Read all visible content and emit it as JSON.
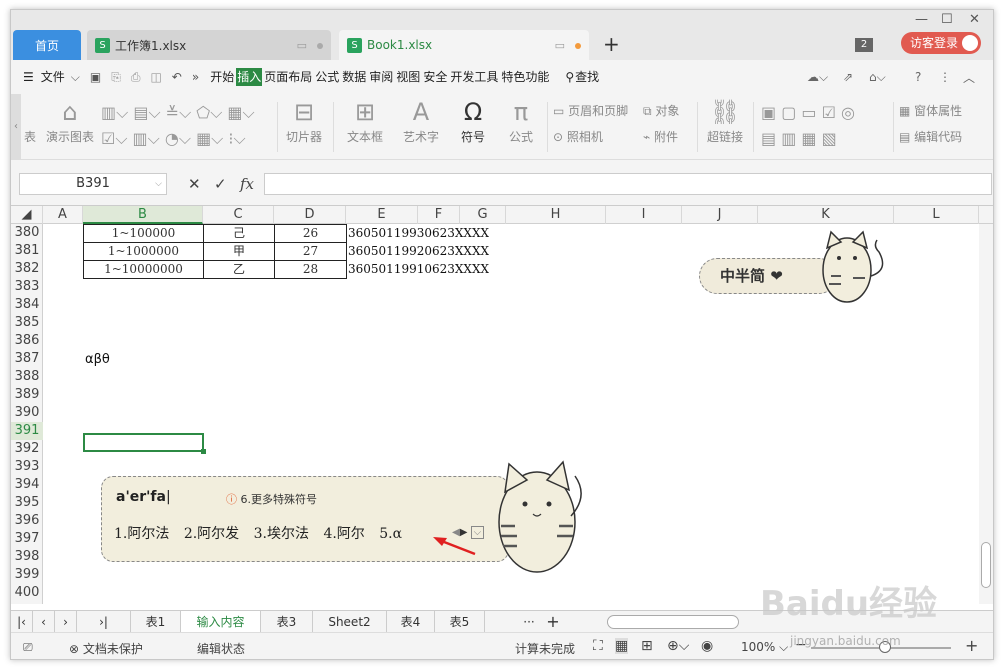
{
  "titlebar": {
    "home_tab": "首页",
    "file_tab": "工作簿1.xlsx",
    "active_tab": "Book1.xlsx",
    "badge": "2",
    "login": "访客登录"
  },
  "menubar": {
    "file": "文件",
    "items": [
      "开始",
      "插入",
      "页面布局",
      "公式",
      "数据",
      "审阅",
      "视图",
      "安全",
      "开发工具",
      "特色功能"
    ],
    "search": "查找"
  },
  "ribbon": {
    "groups": [
      "表",
      "演示图表",
      "切片器",
      "文本框",
      "艺术字",
      "符号",
      "公式",
      "页眉和页脚",
      "对象",
      "照相机",
      "附件",
      "超链接",
      "窗体属性",
      "编辑代码"
    ]
  },
  "formula_bar": {
    "name_box": "B391",
    "fx": "fx",
    "content": ""
  },
  "grid": {
    "columns": [
      "A",
      "B",
      "C",
      "D",
      "E",
      "F",
      "G",
      "H",
      "I",
      "J",
      "K",
      "L"
    ],
    "rows": [
      "380",
      "381",
      "382",
      "383",
      "384",
      "385",
      "386",
      "387",
      "388",
      "389",
      "390",
      "391",
      "392",
      "393",
      "394",
      "395",
      "396",
      "397",
      "398",
      "399",
      "400"
    ],
    "table_rows": [
      [
        "1~100000",
        "己",
        "26",
        "36050119930623XXXX"
      ],
      [
        "1~1000000",
        "甲",
        "27",
        "36050119920623XXXX"
      ],
      [
        "1~10000000",
        "乙",
        "28",
        "36050119910623XXXX"
      ]
    ],
    "b387": "αβθ",
    "selected_cell": "B391"
  },
  "sticker_text": "中半简 ❤",
  "ime": {
    "input": "a'er'fa",
    "more": "6.更多特殊符号",
    "candidates": [
      "1.阿尔法",
      "2.阿尔发",
      "3.埃尔法",
      "4.阿尔",
      "5.α"
    ]
  },
  "sheet_tabs": [
    "表1",
    "输入内容",
    "表3",
    "Sheet2",
    "表4",
    "表5"
  ],
  "active_sheet": "输入内容",
  "statusbar": {
    "protect": "文档未保护",
    "edit": "编辑状态",
    "calc": "计算未完成",
    "zoom": "100%"
  },
  "watermark": {
    "main": "Baidu经验",
    "sub": "jingyan.baidu.com"
  },
  "colors": {
    "accent": "#2c8a44",
    "home_tab": "#3b8fe0",
    "login": "#e15a50"
  }
}
